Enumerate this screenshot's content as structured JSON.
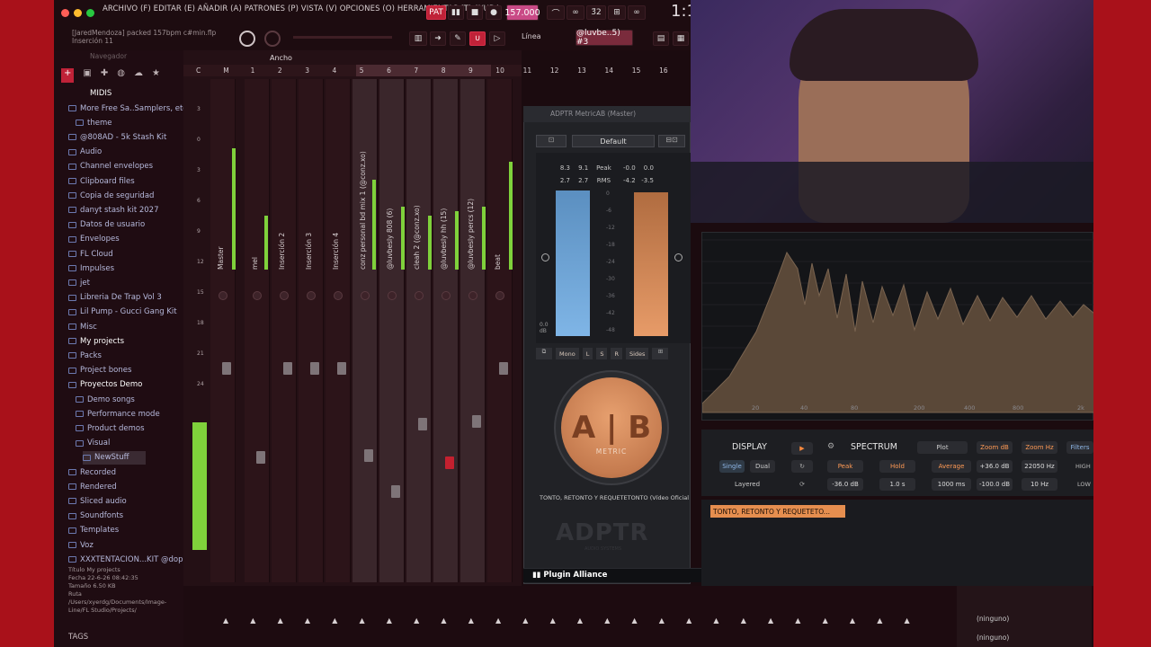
{
  "menu": {
    "text": "ARCHIVO (F) EDITAR (E) AÑADIR (A) PATRONES (P) VISTA (V) OPCIONES (O) HERRAMIENTAS (T) AYUDA"
  },
  "transport": {
    "pat_label": "PAT",
    "tempo": "157.000",
    "time_display": "1:1",
    "tempo_extra": "3̈2"
  },
  "hint": {
    "line1": "[JaredMendoza] packed 157bpm c#min.flp",
    "line2": "Inserción 11"
  },
  "snap": {
    "mode": "Línea",
    "pattern": "@luvbe..5) #3"
  },
  "browser": {
    "header": "Navegador",
    "root": "MIDIS",
    "items": [
      "More Free Sa..Samplers, etc.)",
      "theme",
      "@808AD - 5k Stash Kit",
      "Audio",
      "Channel envelopes",
      "Clipboard files",
      "Copia de seguridad",
      "danyt stash kit 2027",
      "Datos de usuario",
      "Envelopes",
      "FL Cloud",
      "Impulses",
      "jet",
      "Libreria De Trap Vol 3",
      "Lil Pump - Gucci Gang Kit",
      "Misc",
      "My projects",
      "Packs",
      "Project bones",
      "Proyectos Demo",
      "Demo songs",
      "Performance mode",
      "Product demos",
      "Visual",
      "NewStuff",
      "Recorded",
      "Rendered",
      "Sliced audio",
      "Soundfonts",
      "Templates",
      "Voz",
      "XXXTENTACION...KIT @dopekit"
    ],
    "info": {
      "title_label": "Título",
      "title": "My projects",
      "date_label": "Fecha",
      "date": "22-6-26 08:42:35",
      "size_label": "Tamaño",
      "size": "6.50 KB",
      "path_label": "Ruta",
      "path": "/Users/xyerdg/Documents/Image-Line/FL Studio/Projects/"
    },
    "tags": "TAGS"
  },
  "mixer": {
    "width_label": "Ancho",
    "ruler": [
      "C",
      "M",
      "1",
      "2",
      "3",
      "4",
      "5",
      "6",
      "7",
      "8",
      "9",
      "10",
      "11",
      "12",
      "13",
      "14",
      "15",
      "16"
    ],
    "db_scale": [
      "3",
      "0",
      "3",
      "6",
      "9",
      "12",
      "15",
      "18",
      "21",
      "24"
    ],
    "tracks": [
      "Master",
      "mel",
      "Inserción 2",
      "Inserción 3",
      "Inserción 4",
      "conz personal bd mix 1 (@conz.xo)",
      "@luvbesly 808 (6)",
      "cleah 2 (@conz.xo)",
      "@luvbesly hh (15)",
      "@luvbesly percs (12)",
      "beat"
    ]
  },
  "plugin": {
    "title": "ADPTR MetricAB (Master)",
    "preset": "Default",
    "readings": {
      "peak_left": "8.3",
      "peak_right": "9.1",
      "peak_label": "Peak",
      "peak_r1": "-0.0",
      "peak_r2": "0.0",
      "rms_left": "2.7",
      "rms_right": "2.7",
      "rms_label": "RMS",
      "rms_r1": "-4.2",
      "rms_r2": "-3.5"
    },
    "meter_scale": [
      "0",
      "-6",
      "-12",
      "-18",
      "-24",
      "-30",
      "-36",
      "-42",
      "-48"
    ],
    "meter_bottom": "0.0 dB",
    "modes": [
      "Mono",
      "L",
      "S",
      "R",
      "Sides"
    ],
    "ab_label": "A | B",
    "metric": "METRIC",
    "track_name": "TONTO, RETONTO Y REQUETETONTO (Vídeo Oficial) #muy...",
    "logo": "ADPTR",
    "logo_sub": "AUDIO SYSTEMS",
    "vendor": "Plugin Alliance"
  },
  "spectrum": {
    "freq_labels": [
      "20",
      "40",
      "80",
      "200",
      "400",
      "800",
      "2k"
    ],
    "display_label": "DISPLAY",
    "single": "Single",
    "dual": "Dual",
    "layered": "Layered",
    "spectrum_label": "SPECTRUM",
    "plot": "Plot",
    "zoom_db": "Zoom dB",
    "zoom_hz": "Zoom Hz",
    "filters": "Filters",
    "peak": "Peak",
    "hold": "Hold",
    "average": "Average",
    "db_top": "+36.0 dB",
    "hz_top": "22050 Hz",
    "high": "HIGH",
    "peak_val": "-36.0 dB",
    "hold_val": "1.0 s",
    "avg_val": "1000 ms",
    "db_bottom": "-100.0 dB",
    "hz_bottom": "10 Hz",
    "low": "LOW",
    "reference": "TONTO, RETONTO Y REQUETETO..."
  },
  "channel_panel": {
    "slot1": "(ninguno)",
    "slot2": "(ninguno)"
  },
  "colors": {
    "accent": "#c02238",
    "meter_green": "#7fd13b",
    "ab_orange": "#d9895a",
    "ab_blue": "#5aa0d8",
    "spectrum_fill": "#5a4838"
  }
}
